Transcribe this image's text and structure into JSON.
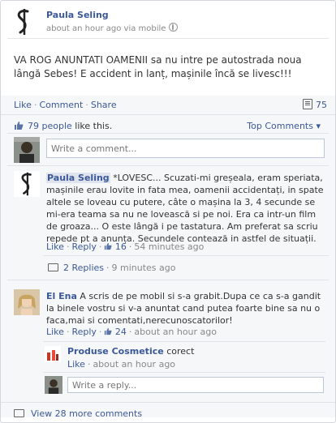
{
  "post": {
    "author": "Paula Seling",
    "meta": "about an hour ago via mobile",
    "text": "VA ROG ANUNTATI OAMENII sa nu intre pe autostrada noua lângă Sebes! E accident in lanț, mașinile încă se livesc!!!"
  },
  "actions": {
    "like": "Like",
    "comment": "Comment",
    "share": "Share",
    "sep": "·",
    "count": "75"
  },
  "likes": {
    "people": "79 people",
    "suffix": " like this.",
    "top_comments": "Top Comments"
  },
  "composer": {
    "placeholder": "Write a comment..."
  },
  "comments": [
    {
      "author": "Paula Seling",
      "text": "*LOVESC... Scuzati-mi greșeala, eram speriata, mașinile erau lovite in fata mea, oamenii accidentați, in spate altele se loveau cu putere, câte o mașina la 3, 4 secunde se mi-era teama sa nu ne lovească si pe noi. Era ca intr-un film de groaza... O este lângă i pe tastatura. Am preferat sa scriu repede pt a anunța. Secundele contează in astfel de situații.",
      "like": "Like",
      "reply": "Reply",
      "like_count": "16",
      "time": "54 minutes ago",
      "replies_link": "2 Replies",
      "replies_time": "9 minutes ago"
    },
    {
      "author": "El Ena",
      "text": "A scris de pe mobil si s-a grabit.Dupa ce ca s-a gandit la binele vostru si v-a anuntat cand putea foarte bine sa nu o faca,mai si comentati,nerecunoscatorilor!",
      "like": "Like",
      "reply": "Reply",
      "like_count": "24",
      "time": "about an hour ago"
    }
  ],
  "reply": {
    "author": "Produse Cosmetice",
    "text": "corect",
    "like": "Like",
    "time": "about an hour ago",
    "placeholder": "Write a reply..."
  },
  "view_more": "View 28 more comments"
}
